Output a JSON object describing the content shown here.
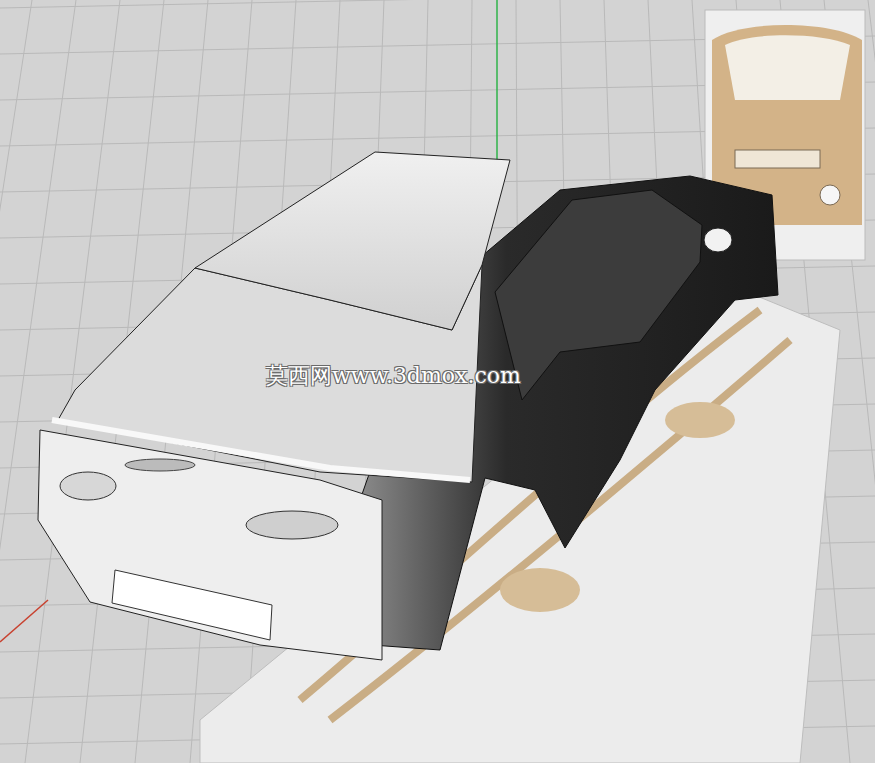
{
  "viewport": {
    "watermark": "莫西网www.3dmox.com"
  }
}
